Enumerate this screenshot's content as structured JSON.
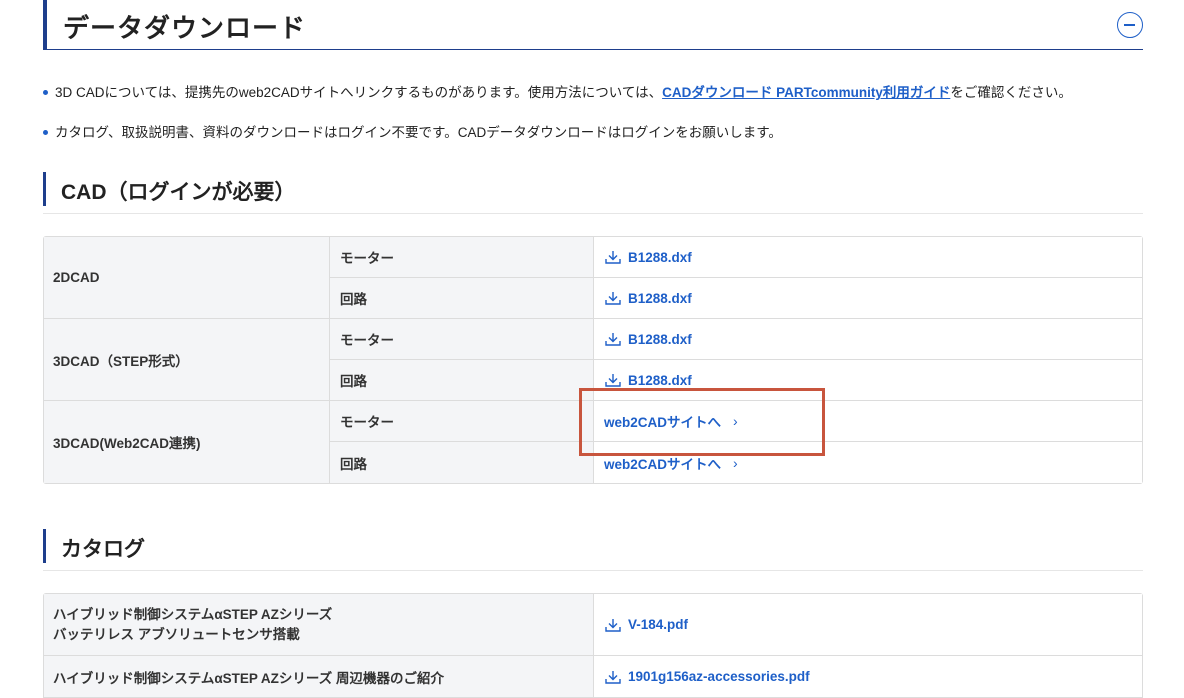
{
  "section": {
    "title": "データダウンロード",
    "collapse_icon": "minus-circle-icon"
  },
  "notes": {
    "n1_prefix": "3D CADについては、提携先のweb2CADサイトへリンクするものがあります。使用方法については、",
    "n1_link": "CADダウンロード PARTcommunity利用ガイド",
    "n1_suffix": "をご確認ください。",
    "n2": "カタログ、取扱説明書、資料のダウンロードはログイン不要です。CADデータダウンロードはログインをお願いします。"
  },
  "cad": {
    "heading": "CAD（ログインが必要）",
    "rows": [
      {
        "category": "2DCAD",
        "motor_label": "モーター",
        "motor_value": "B1288.dxf",
        "circuit_label": "回路",
        "circuit_value": "B1288.dxf"
      },
      {
        "category": "3DCAD（STEP形式）",
        "motor_label": "モーター",
        "motor_value": "B1288.dxf",
        "circuit_label": "回路",
        "circuit_value": "B1288.dxf"
      },
      {
        "category": "3DCAD(Web2CAD連携)",
        "motor_label": "モーター",
        "motor_value": "web2CADサイトへ",
        "circuit_label": "回路",
        "circuit_value": "web2CADサイトへ"
      }
    ]
  },
  "catalog": {
    "heading": "カタログ",
    "rows": [
      {
        "label_line1": "ハイブリッド制御システムαSTEP AZシリーズ",
        "label_line2": "バッテリレス アブソリュートセンサ搭載",
        "file": "V-184.pdf"
      },
      {
        "label_line1": "ハイブリッド制御システムαSTEP AZシリーズ 周辺機器のご紹介",
        "file": "1901g156az-accessories.pdf"
      }
    ]
  },
  "icons": {
    "download": "download-icon",
    "chevron": "chevron-right-icon"
  },
  "colors": {
    "accent": "#1e5fc8",
    "heading_bar": "#1e3e8c",
    "highlight": "#c8553d"
  }
}
